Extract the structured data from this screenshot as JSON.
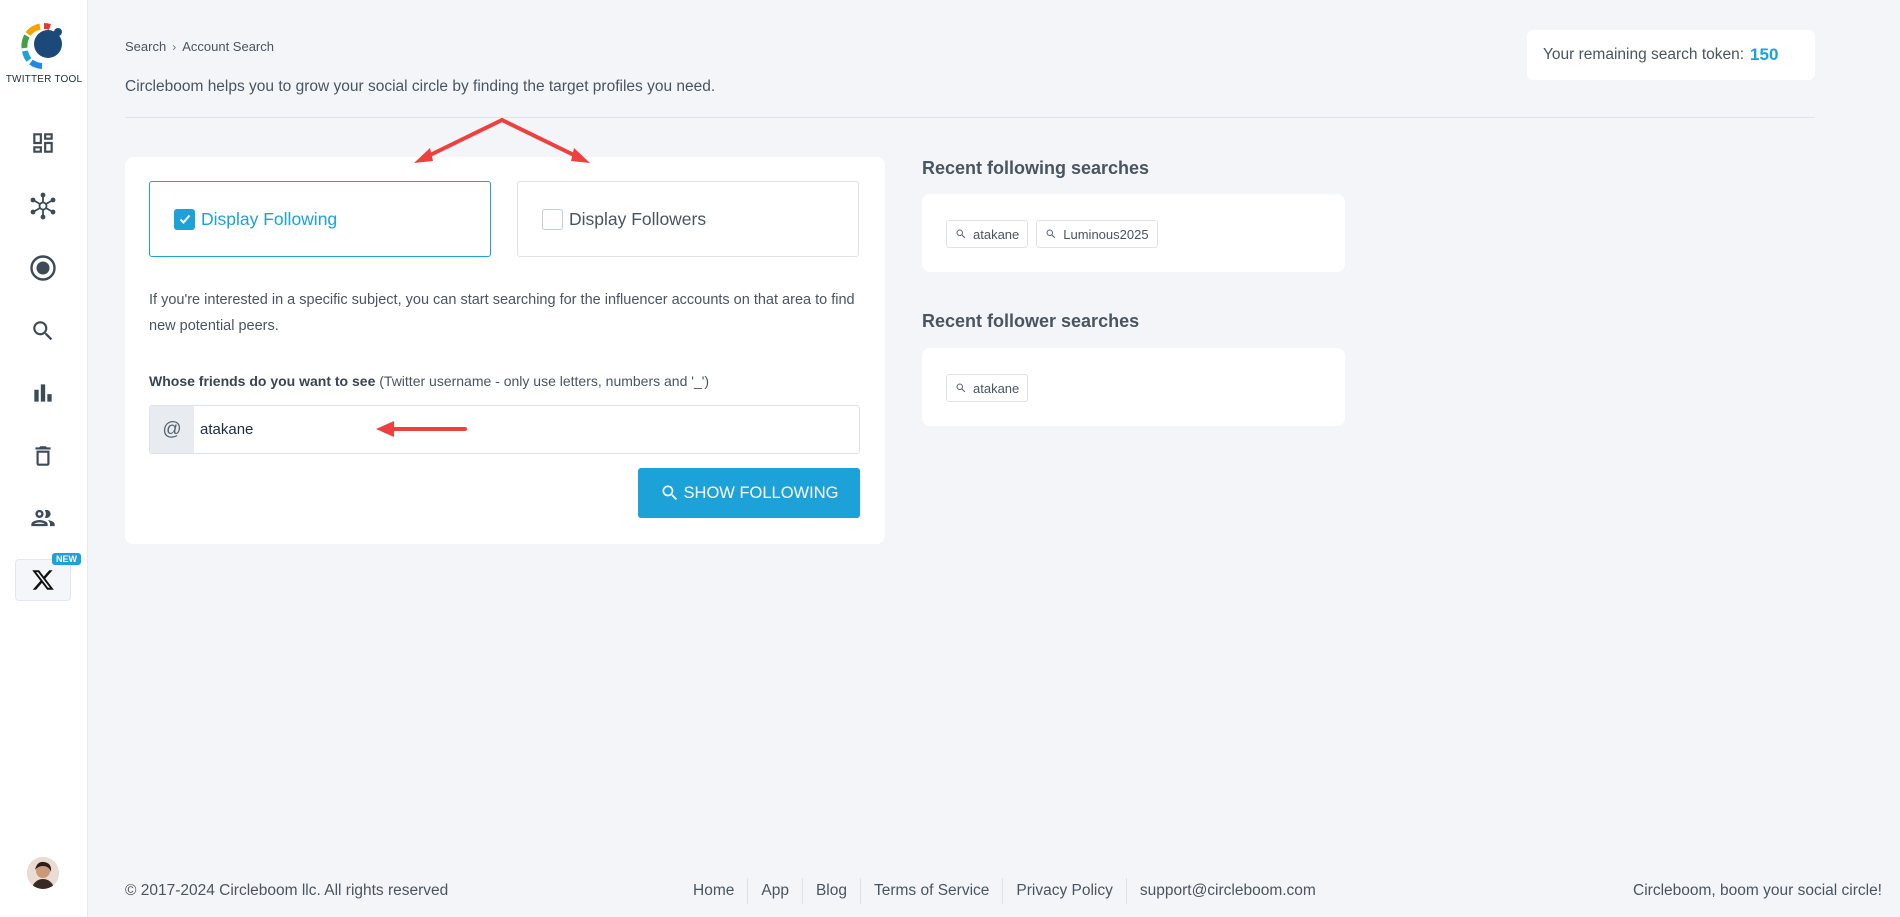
{
  "sidebar": {
    "logo_text": "TWITTER TOOL",
    "new_badge": "NEW",
    "items": [
      {
        "name": "dashboard",
        "icon": "dashboard-icon"
      },
      {
        "name": "circle",
        "icon": "network-icon"
      },
      {
        "name": "record",
        "icon": "radio-target-icon"
      },
      {
        "name": "search",
        "icon": "search-icon"
      },
      {
        "name": "analytics",
        "icon": "bar-chart-icon"
      },
      {
        "name": "delete",
        "icon": "trash-icon"
      },
      {
        "name": "users",
        "icon": "people-icon"
      },
      {
        "name": "x",
        "icon": "x-logo-icon"
      }
    ]
  },
  "header": {
    "breadcrumb": [
      "Search",
      "Account Search"
    ],
    "subtitle": "Circleboom helps you to grow your social circle by finding the target profiles you need.",
    "token_label": "Your remaining search token:",
    "token_value": "150"
  },
  "form": {
    "option_following": "Display Following",
    "option_followers": "Display Followers",
    "following_checked": true,
    "followers_checked": false,
    "description": "If you're interested in a specific subject, you can start searching for the influencer accounts on that area to find new potential peers.",
    "label_bold": "Whose friends do you want to see",
    "label_hint": "(Twitter username - only use letters, numbers and '_')",
    "at_symbol": "@",
    "username_value": "atakane",
    "button_label": "SHOW FOLLOWING"
  },
  "recent": {
    "following_title": "Recent following searches",
    "following_tags": [
      "atakane",
      "Luminous2025"
    ],
    "follower_title": "Recent follower searches",
    "follower_tags": [
      "atakane"
    ]
  },
  "footer": {
    "copyright": "© 2017-2024 Circleboom llc. All rights reserved",
    "links": [
      "Home",
      "App",
      "Blog",
      "Terms of Service",
      "Privacy Policy",
      "support@circleboom.com"
    ],
    "tagline": "Circleboom, boom your social circle!"
  },
  "colors": {
    "accent": "#1da1d9",
    "annotation_arrow": "#ef4040",
    "background": "#f3f5f9"
  }
}
